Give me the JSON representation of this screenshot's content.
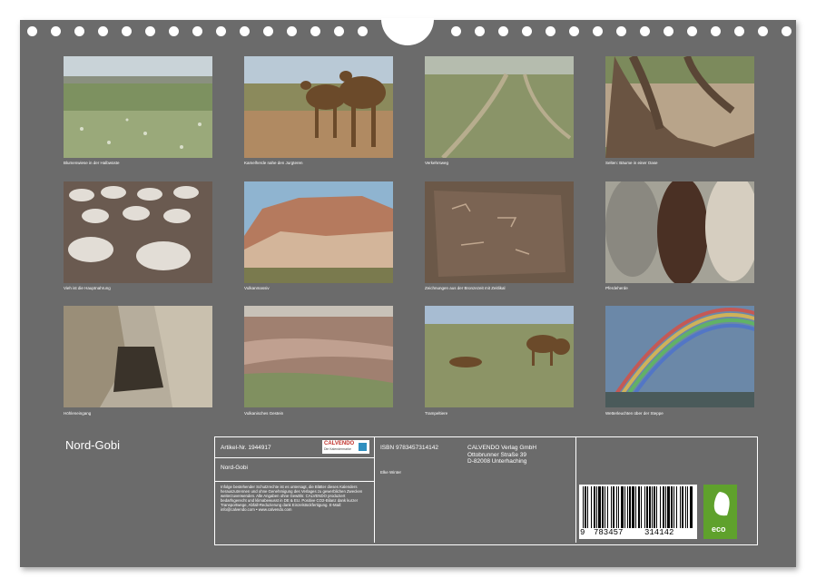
{
  "photos": [
    {
      "caption": "Blumenwiese in der Halbwüste"
    },
    {
      "caption": "Kamelherde nahe den Jurgteren"
    },
    {
      "caption": "Verkehrsweg"
    },
    {
      "caption": "Selten: Bäume in einer Oase"
    },
    {
      "caption": "Vieh ist die Hauptnahrung"
    },
    {
      "caption": "Vulkanmassiv"
    },
    {
      "caption": "Zeichnungen aus der Bronzezeit mit Zeitlikal"
    },
    {
      "caption": "Pferdeherde"
    },
    {
      "caption": "Höhleneingang"
    },
    {
      "caption": "Vulkanisches Gestein"
    },
    {
      "caption": "Trampeltiere"
    },
    {
      "caption": "Wetterleuchten über der Steppe"
    }
  ],
  "title": "Nord-Gobi",
  "info": {
    "artikel": "Artikel-Nr. 1944917",
    "logo": "CALVENDO",
    "logo_sub": "Die Kalendermarke",
    "name": "Nord-Gobi",
    "legal": "Infolge bestehender Schutzrechte ist es untersagt, die Blätter dieses Kalenders herauszutrennen und ohne Genehmigung des Verlages zu gewerblichen Zwecken weiterzuverwenden. Alle Angaben ohne Gewähr. CALVENDO produziert bedarfsgerecht und klimabewusst in DE & EU. Positive CO2-Bilanz dank kurzer Transportwege, Abfall-Reduzierung dank Einzelstückfertigung. E-Mail: info@calvendo.com • www.calvendo.com",
    "isbn": "ISBN 9783457314142",
    "publisher": [
      "CALVENDO Verlag GmbH",
      "Ottobrunner Straße 39",
      "D-82008 Unterhaching"
    ],
    "author": "Elke Winter",
    "barcode_digits": [
      "9",
      "783457",
      "314142"
    ],
    "eco": "eco"
  }
}
